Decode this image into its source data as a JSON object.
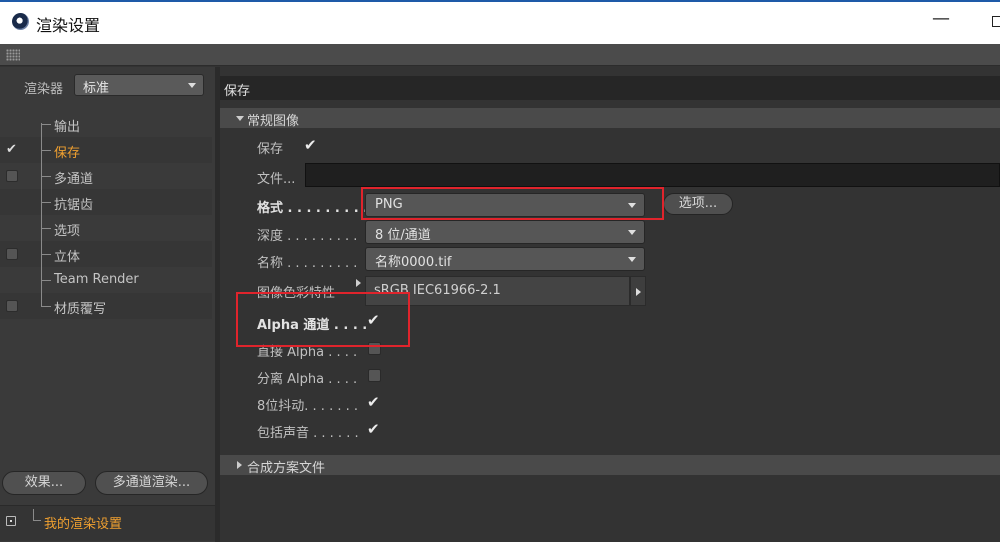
{
  "window": {
    "title": "渲染设置",
    "minimize_glyph": "—"
  },
  "left_panel": {
    "renderer_label": "渲染器",
    "renderer_value": "标准",
    "tree": [
      {
        "label": "输出",
        "checkbox": "none"
      },
      {
        "label": "保存",
        "checkbox": "checked",
        "selected": true
      },
      {
        "label": "多通道",
        "checkbox": "unchecked"
      },
      {
        "label": "抗锯齿",
        "checkbox": "none"
      },
      {
        "label": "选项",
        "checkbox": "none"
      },
      {
        "label": "立体",
        "checkbox": "unchecked"
      },
      {
        "label": "Team Render",
        "checkbox": "none"
      },
      {
        "label": "材质覆写",
        "checkbox": "unchecked"
      }
    ],
    "effects_button": "效果...",
    "multipass_button": "多通道渲染...",
    "preset_name": "我的渲染设置"
  },
  "right_panel": {
    "page_title": "保存",
    "section_general": "常规图像",
    "section_compositing": "合成方案文件",
    "fields": {
      "save_label": "保存",
      "save_checked": true,
      "file_label": "文件...",
      "file_value": "",
      "format_label": "格式 . . . . . . . . .",
      "format_value": "PNG",
      "options_button": "选项...",
      "depth_label": "深度 . . . . . . . . .",
      "depth_value": "8 位/通道",
      "name_label": "名称 . . . . . . . . .",
      "name_value": "名称0000.tif",
      "color_profile_label": "图像色彩特性",
      "color_profile_value": "sRGB IEC61966-2.1",
      "alpha_label": "Alpha 通道 . . . .",
      "alpha_checked": true,
      "straight_alpha_label": "直接 Alpha . . . .",
      "straight_alpha_checked": false,
      "separate_alpha_label": "分离 Alpha . . . .",
      "separate_alpha_checked": false,
      "dithering_label": "8位抖动. . . . . . .",
      "dithering_checked": true,
      "include_sound_label": "包括声音 . . . . . .",
      "include_sound_checked": true
    }
  },
  "colors": {
    "background": "#333333",
    "accent_orange": "#f0a030",
    "highlight_red": "#e0242c",
    "titlebar": "#ffffff"
  },
  "icons": {
    "check": "✔",
    "app": "cinema4d-icon"
  }
}
